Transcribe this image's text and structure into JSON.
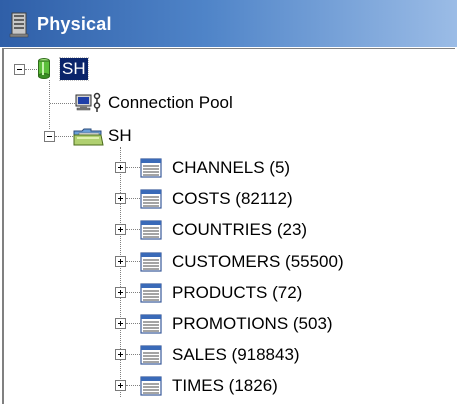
{
  "header": {
    "title": "Physical"
  },
  "tree": {
    "root": {
      "label": "SH"
    },
    "connection_pool": {
      "label": "Connection Pool"
    },
    "schema": {
      "label": "SH"
    },
    "tables": [
      {
        "label": "CHANNELS (5)"
      },
      {
        "label": "COSTS (82112)"
      },
      {
        "label": "COUNTRIES (23)"
      },
      {
        "label": "CUSTOMERS (55500)"
      },
      {
        "label": "PRODUCTS (72)"
      },
      {
        "label": "PROMOTIONS (503)"
      },
      {
        "label": "SALES (918843)"
      },
      {
        "label": "TIMES (1826)"
      }
    ]
  },
  "colors": {
    "header_start": "#2f5fa8",
    "header_end": "#9bbce6",
    "selection": "#0a246a"
  },
  "icons": {
    "header": "server-icon",
    "root": "database-cylinder-icon",
    "connection_pool": "connection-pool-icon",
    "schema": "folder-icon",
    "table": "table-icon"
  }
}
